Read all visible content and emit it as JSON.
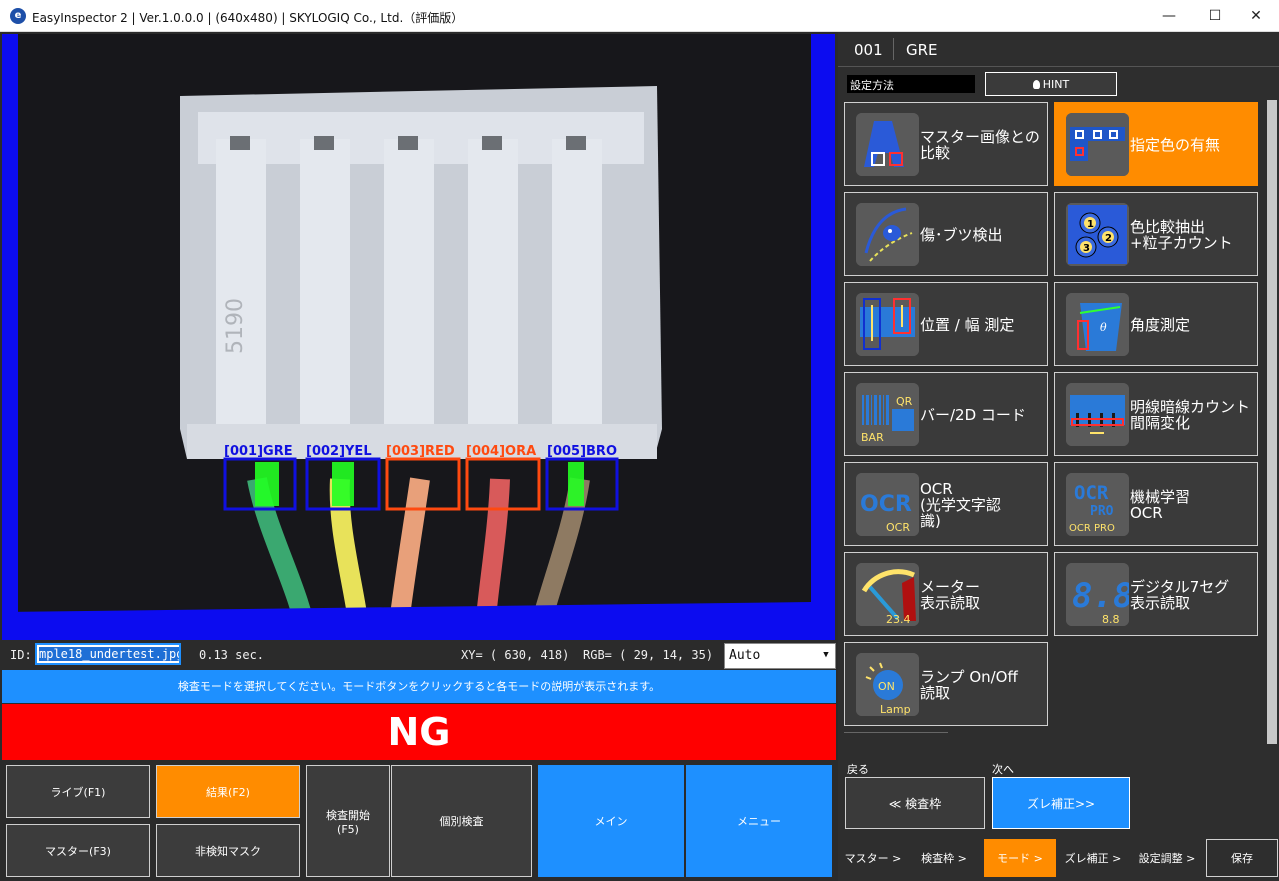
{
  "window": {
    "title": "EasyInspector 2 | Ver.1.0.0.0 | (640x480) | SKYLOGIQ Co., Ltd.（評価版）",
    "controls": {
      "minimize": "—",
      "maximize": "☐",
      "close": "✕"
    }
  },
  "camera": {
    "roi_labels": [
      "[001]GRE",
      "[002]YEL",
      "[003]RED",
      "[004]ORA",
      "[005]BRO"
    ],
    "roi_colors": [
      "#1010e0",
      "#1010e0",
      "#ff4a10",
      "#ff4a10",
      "#1010e0"
    ],
    "connector_marking": "5190"
  },
  "info": {
    "id_label": "ID:",
    "id_value": "mple18_undertest.jpg",
    "time": "0.13 sec.",
    "xy": "XY= ( 630,  418)",
    "rgb": "RGB= ( 29,  14,  35)",
    "mode_select": "Auto"
  },
  "instruction": "検査モードを選択してください。モードボタンをクリックすると各モードの説明が表示されます。",
  "result": "NG",
  "buttons": {
    "live": "ライブ(F1)",
    "result": "結果(F2)",
    "master": "マスター(F3)",
    "mask": "非検知マスク",
    "start": "検査開始\n(F5)",
    "individual": "個別検査",
    "main": "メイン",
    "menu": "メニュー"
  },
  "right": {
    "frame_no": "001",
    "frame_name": "GRE",
    "method_label": "設定方法",
    "hint": "HINT",
    "modes": [
      {
        "label": "マスター画像との\n比較",
        "icon": "master-compare-icon"
      },
      {
        "label": "指定色の有無",
        "icon": "color-presence-icon",
        "active": true
      },
      {
        "label": "傷･ブツ検出",
        "icon": "scratch-detect-icon"
      },
      {
        "label": "色比較抽出\n+粒子カウント",
        "icon": "particle-count-icon"
      },
      {
        "label": "位置 / 幅 測定",
        "icon": "position-width-icon"
      },
      {
        "label": "角度測定",
        "icon": "angle-measure-icon"
      },
      {
        "label": "バー/2D コード",
        "icon": "barcode-icon"
      },
      {
        "label": "明線暗線カウント\n間隔変化",
        "icon": "line-count-icon"
      },
      {
        "label": "OCR\n(光学文字認\n識)",
        "icon": "ocr-icon"
      },
      {
        "label": "機械学習\nOCR",
        "icon": "ml-ocr-icon"
      },
      {
        "label": "メーター\n表示読取",
        "icon": "meter-icon"
      },
      {
        "label": "デジタル7セグ\n表示読取",
        "icon": "seven-seg-icon"
      },
      {
        "label": "ランプ On/Off\n読取",
        "icon": "lamp-icon"
      }
    ],
    "icon_text": {
      "bar": "BAR",
      "qr": "QR",
      "ocr": "OCR",
      "ocr_small": "OCR",
      "ocr_pro_top": "OCR",
      "ocr_pro_mid": "PRO",
      "ocr_pro_small": "OCR PRO",
      "meter_value": "23.4",
      "seg_big": "8.8",
      "seg_small": "8.8",
      "lamp_on": "ON",
      "lamp_word": "Lamp",
      "theta": "θ",
      "p1": "1",
      "p2": "2",
      "p3": "3"
    },
    "back_label": "戻る",
    "next_label": "次へ",
    "back_button": "≪ 検査枠",
    "next_button": "ズレ補正>>",
    "nav": [
      {
        "label": "マスター >"
      },
      {
        "label": "検査枠 >"
      },
      {
        "label": "モード >",
        "active": true
      },
      {
        "label": "ズレ補正 >"
      },
      {
        "label": "設定調整 >"
      }
    ],
    "save": "保存"
  }
}
